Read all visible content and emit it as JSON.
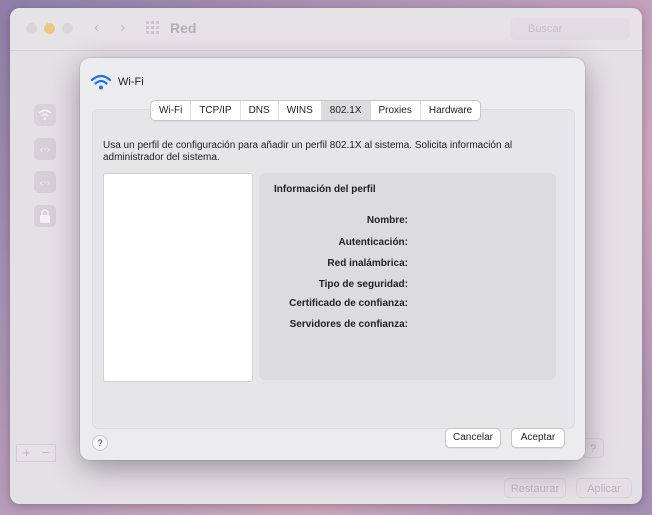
{
  "background_window": {
    "title": "Red",
    "search_placeholder": "Buscar",
    "restore_label": "Restaurar",
    "apply_label": "Aplicar",
    "add_label": "+",
    "remove_label": "−"
  },
  "sheet": {
    "title": "Wi-Fi",
    "tabs": [
      {
        "label": "Wi-Fi"
      },
      {
        "label": "TCP/IP"
      },
      {
        "label": "DNS"
      },
      {
        "label": "WINS"
      },
      {
        "label": "802.1X",
        "active": true
      },
      {
        "label": "Proxies"
      },
      {
        "label": "Hardware"
      }
    ],
    "description": "Usa un perfil de configuración para añadir un perfil 802.1X al sistema. Solicita información al administrador del sistema.",
    "profile_info": {
      "title": "Información del perfil",
      "fields": [
        "Nombre:",
        "Autenticación:",
        "Red inalámbrica:",
        "Tipo de seguridad:",
        "Certificado de confianza:",
        "Servidores de confianza:"
      ]
    },
    "help_label": "?",
    "cancel_label": "Cancelar",
    "accept_label": "Aceptar"
  },
  "colors": {
    "accent": "#1a73e8",
    "sheet_bg": "#ececee",
    "panel_bg": "#e6e5e8",
    "traffic_yellow": "#f2c14b"
  }
}
